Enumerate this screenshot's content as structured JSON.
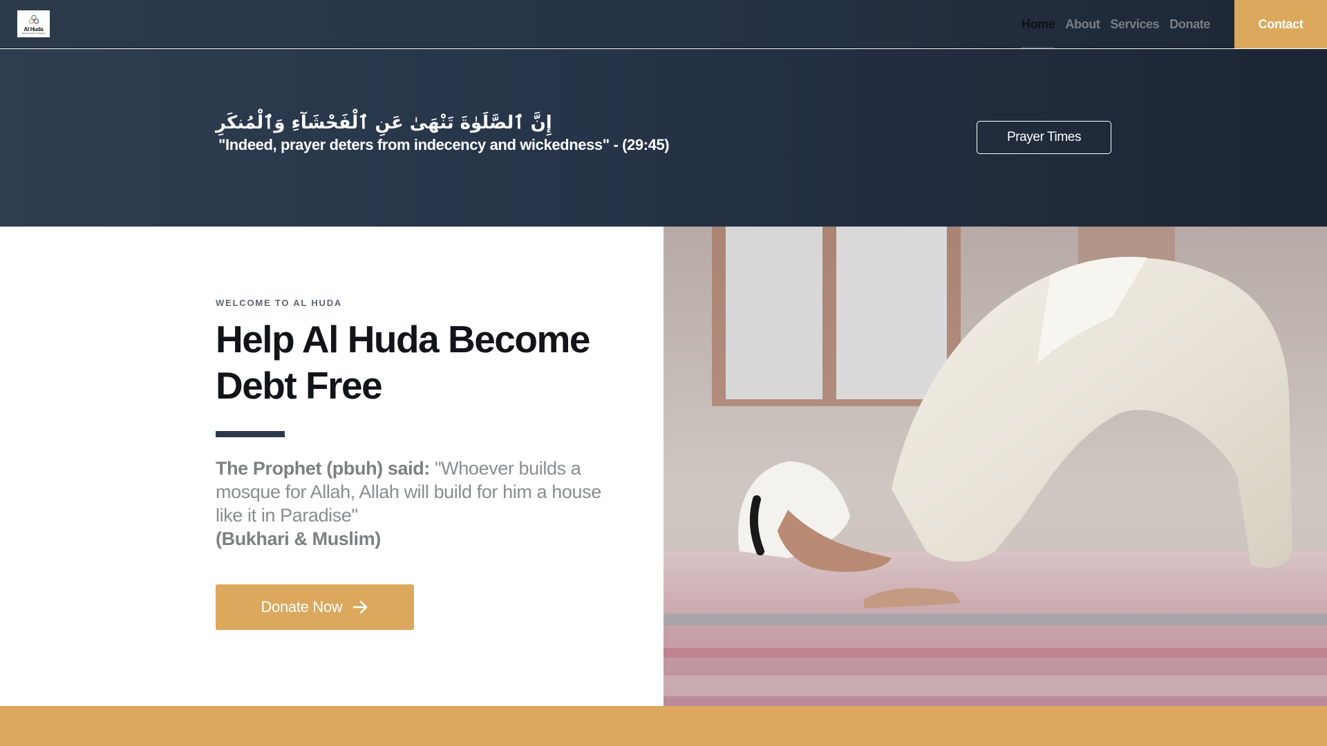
{
  "brand": {
    "logo_text": "Al Huda",
    "logo_subtext": "Islamic Center of Chicago"
  },
  "nav": {
    "items": [
      {
        "label": "Home",
        "active": true
      },
      {
        "label": "About",
        "active": false
      },
      {
        "label": "Services",
        "active": false
      },
      {
        "label": "Donate",
        "active": false
      }
    ],
    "contact_label": "Contact"
  },
  "quote": {
    "arabic": "إِنَّ ٱلصَّلَوٰةَ تَنْهَىٰ عَنِ ٱلْفَحْشَآءِ وَٱلْمُنكَرِ",
    "translation": "\"Indeed,  prayer deters from indecency and wickedness\" - (29:45)",
    "prayer_times_label": "Prayer Times"
  },
  "hero": {
    "eyebrow": "WELCOME TO AL HUDA",
    "headline": "Help Al Huda Become Debt Free",
    "hadith_lead": "The Prophet (pbuh) said:",
    "hadith_text": " \"Whoever builds a mosque for Allah, Allah will build for him a house like it in Paradise\"",
    "hadith_source": "(Bukhari & Muslim)",
    "donate_label": "Donate Now",
    "image_alt": "Man prostrating in prayer on a mosque carpet"
  },
  "colors": {
    "accent_gold": "#dba85d",
    "navy": "#253243",
    "divider": "#2d3a4a"
  },
  "icons": {
    "donate_arrow": "arrow-right-icon"
  }
}
